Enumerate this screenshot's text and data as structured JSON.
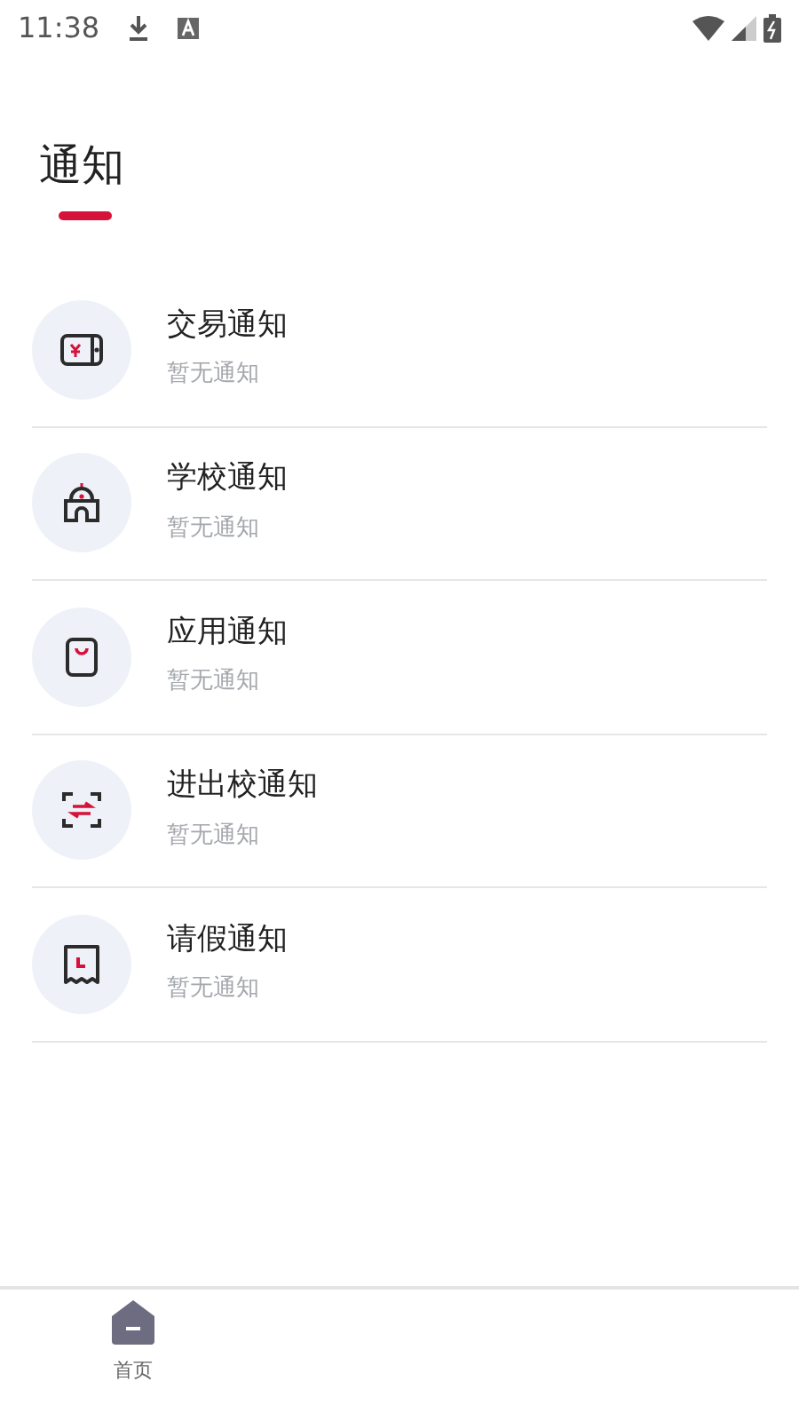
{
  "status_bar": {
    "time": "11:38"
  },
  "page": {
    "title": "通知"
  },
  "notifications": [
    {
      "kind": "wallet",
      "title": "交易通知",
      "subtitle": "暂无通知"
    },
    {
      "kind": "school",
      "title": "学校通知",
      "subtitle": "暂无通知"
    },
    {
      "kind": "bag",
      "title": "应用通知",
      "subtitle": "暂无通知"
    },
    {
      "kind": "scan",
      "title": "进出校通知",
      "subtitle": "暂无通知"
    },
    {
      "kind": "receipt",
      "title": "请假通知",
      "subtitle": "暂无通知"
    }
  ],
  "bottom_nav": [
    {
      "label": "首页",
      "selected": true
    }
  ]
}
